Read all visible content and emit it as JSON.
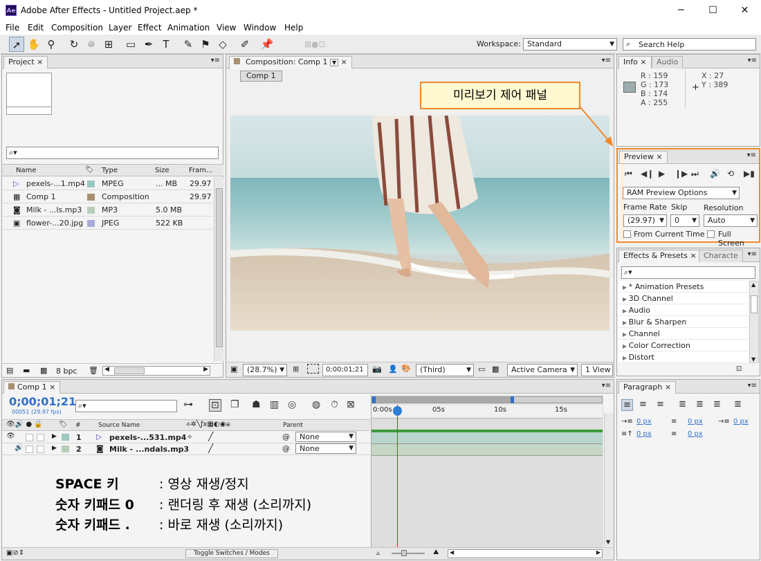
{
  "titlebar": {
    "app_icon": "Ae",
    "title": "Adobe After Effects - Untitled Project.aep *",
    "min": "─",
    "max": "☐",
    "close": "✕"
  },
  "menu": [
    "File",
    "Edit",
    "Composition",
    "Layer",
    "Effect",
    "Animation",
    "View",
    "Window",
    "Help"
  ],
  "toolbar": {
    "workspace_label": "Workspace:",
    "workspace_value": "Standard",
    "search_placeholder": "Search Help"
  },
  "project": {
    "tab": "Project",
    "search": "⌕▾",
    "columns": {
      "name": "Name",
      "type": "Type",
      "size": "Size",
      "fps": "Fram..."
    },
    "items": [
      {
        "name": "pexels-...1.mp4",
        "type": "MPEG",
        "size": "... MB",
        "fps": "29.97",
        "color": "#9dc9c0"
      },
      {
        "name": "Comp 1",
        "type": "Composition",
        "size": "",
        "fps": "29.97",
        "color": "#a89170"
      },
      {
        "name": "Milk - ...ls.mp3",
        "type": "MP3",
        "size": "5.0 MB",
        "fps": "",
        "color": "#b8cdb8"
      },
      {
        "name": "flower-...20.jpg",
        "type": "JPEG",
        "size": "522 KB",
        "fps": "",
        "color": "#a9acd6"
      }
    ],
    "bpc": "8 bpc"
  },
  "composition": {
    "tab": "Composition: Comp 1",
    "sub_tab": "Comp 1",
    "zoom": "(28.7%)",
    "timecode": "0;00;01;21",
    "resolution": "(Third)",
    "camera": "Active Camera",
    "views": "1 View"
  },
  "info": {
    "tab": "Info",
    "tab2": "Audio",
    "r": "R : 159",
    "g": "G : 173",
    "b": "B : 174",
    "a": "A : 255",
    "x": "X : 27",
    "y": "Y : 389",
    "swatch": "#9fadae"
  },
  "preview": {
    "tab": "Preview",
    "ram_options": "RAM Preview Options",
    "frame_rate_label": "Frame Rate",
    "skip_label": "Skip",
    "resolution_label": "Resolution",
    "frame_rate": "(29.97)",
    "skip": "0",
    "resolution": "Auto",
    "from_current": "From Current Time",
    "full_screen": "Full Screen"
  },
  "effects": {
    "tab": "Effects & Presets",
    "tab2": "Characte",
    "items": [
      "* Animation Presets",
      "3D Channel",
      "Audio",
      "Blur & Sharpen",
      "Channel",
      "Color Correction",
      "Distort"
    ]
  },
  "paragraph": {
    "tab": "Paragraph",
    "indent_values": [
      "0 px",
      "0 px",
      "0 px",
      "0 px",
      "0 px"
    ]
  },
  "timeline": {
    "tab": "Comp 1",
    "timecode": "0;00;01;21",
    "frames": "00051 (29.97 fps)",
    "cols": {
      "source": "Source Name",
      "parent": "Parent",
      "num": "#"
    },
    "ruler": [
      "0:00s",
      "05s",
      "10s",
      "15s"
    ],
    "layers": [
      {
        "num": "1",
        "name": "pexels-...531.mp4",
        "parent": "None",
        "color": "#9dc9c0"
      },
      {
        "num": "2",
        "name": "Milk - ...ndals.mp3",
        "parent": "None",
        "color": "#b8cdb8"
      }
    ],
    "toggle": "Toggle Switches / Modes"
  },
  "annotations": {
    "callout": "미리보기 제어 패널",
    "lines": [
      {
        "key": "SPACE 키",
        "desc": ": 영상 재생/정지"
      },
      {
        "key": "숫자 키패드  0",
        "desc": ": 랜더링 후 재생 (소리까지)"
      },
      {
        "key": "숫자 키패드  .",
        "desc": ": 바로 재생 (소리까지)"
      }
    ],
    "accent": "#f08a2c"
  }
}
